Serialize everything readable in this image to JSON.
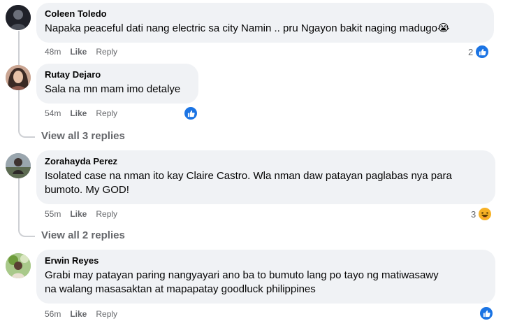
{
  "comments": [
    {
      "author": "Coleen Toledo",
      "text": "Napaka peaceful dati nang electric sa city Namin .. pru Ngayon bakit naging madugo😭",
      "time": "48m",
      "like_label": "Like",
      "reply_label": "Reply",
      "reaction_count": "2",
      "reaction_icon": "like-icon"
    },
    {
      "author": "Rutay Dejaro",
      "text": "Sala na mn mam imo detalye",
      "time": "54m",
      "like_label": "Like",
      "reply_label": "Reply",
      "reaction_icon": "like-icon",
      "view_replies": "View all 3 replies"
    },
    {
      "author": "Zorahayda Perez",
      "text_line1": "Isolated case na nman ito kay Claire Castro. Wla nman daw patayan paglabas nya para",
      "text_line2": "bumoto. My GOD!",
      "time": "55m",
      "like_label": "Like",
      "reply_label": "Reply",
      "reaction_count": "3",
      "reaction_icon": "haha-icon",
      "view_replies": "View all 2 replies"
    },
    {
      "author": "Erwin Reyes",
      "text_line1": "Grabi may patayan paring nangyayari ano ba to bumuto lang po tayo ng matiwasawy",
      "text_line2": "na walang masasaktan at mapapatay goodluck philippines",
      "time": "56m",
      "like_label": "Like",
      "reply_label": "Reply",
      "reaction_icon": "like-icon"
    }
  ],
  "colors": {
    "bubble": "#f0f2f5",
    "meta": "#65676b",
    "like_blue": "#1b74e4",
    "haha_yellow": "#f7b125"
  }
}
